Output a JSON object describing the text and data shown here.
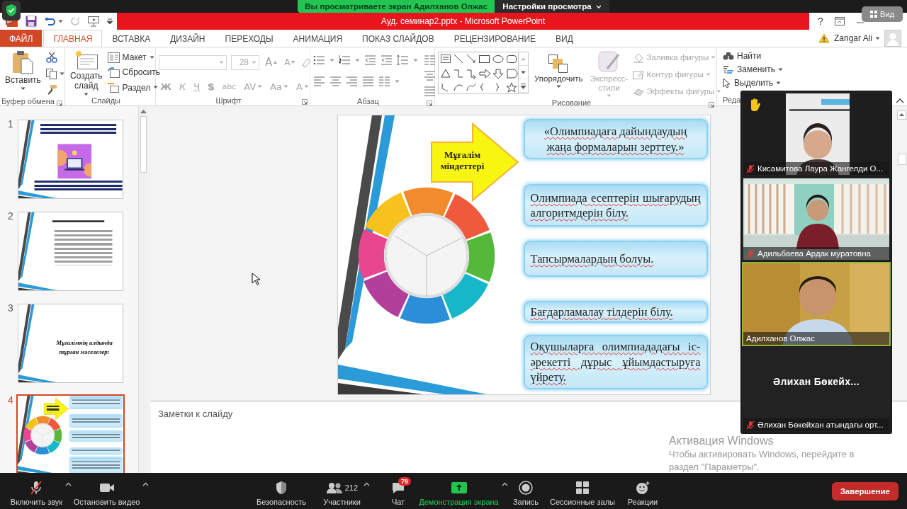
{
  "zoom_bar": {
    "viewing_notice": "Вы просматриваете экран Адилханов Олжас",
    "view_options": "Настройки просмотра",
    "view_button": "Вид"
  },
  "window": {
    "title": "Ауд. семинар2.pptx - Microsoft PowerPoint",
    "help": "?"
  },
  "ribbon_tabs": [
    {
      "label": "ФАЙЛ",
      "kind": "file",
      "selected": false
    },
    {
      "label": "ГЛАВНАЯ",
      "kind": "tab",
      "selected": true
    },
    {
      "label": "ВСТАВКА",
      "kind": "tab",
      "selected": false
    },
    {
      "label": "ДИЗАЙН",
      "kind": "tab",
      "selected": false
    },
    {
      "label": "ПЕРЕХОДЫ",
      "kind": "tab",
      "selected": false
    },
    {
      "label": "АНИМАЦИЯ",
      "kind": "tab",
      "selected": false
    },
    {
      "label": "ПОКАЗ СЛАЙДОВ",
      "kind": "tab",
      "selected": false
    },
    {
      "label": "РЕЦЕНЗИРОВАНИЕ",
      "kind": "tab",
      "selected": false
    },
    {
      "label": "ВИД",
      "kind": "tab",
      "selected": false
    }
  ],
  "account": {
    "name": "Zangar Ali"
  },
  "ribbon": {
    "clipboard": {
      "label": "Буфер обмена",
      "paste": "Вставить"
    },
    "slides": {
      "label": "Слайды",
      "new_slide": "Создать слайд",
      "commands": [
        {
          "label": "Макет",
          "kind": "layout",
          "menu": true
        },
        {
          "label": "Сбросить",
          "kind": "reset",
          "menu": false
        },
        {
          "label": "Раздел",
          "kind": "section",
          "menu": true
        }
      ]
    },
    "font": {
      "label": "Шрифт",
      "disabled": true,
      "size": "28",
      "size_buttons": [
        {
          "label": "A",
          "kind": "grow"
        },
        {
          "label": "A",
          "kind": "shrink"
        }
      ],
      "format_buttons": [
        {
          "label": "Ж",
          "kind": "bold",
          "menu": false
        },
        {
          "label": "К",
          "kind": "italic",
          "menu": false
        },
        {
          "label": "Ч",
          "kind": "underline",
          "menu": false
        },
        {
          "label": "S",
          "kind": "shadow",
          "menu": false
        },
        {
          "label": "abc",
          "kind": "strikethrough",
          "menu": false
        },
        {
          "label": "AV",
          "kind": "spacing",
          "menu": true
        },
        {
          "label": "Aa",
          "kind": "case",
          "menu": true
        },
        {
          "label": "A",
          "kind": "color",
          "menu": true
        }
      ]
    },
    "paragraph": {
      "label": "Абзац"
    },
    "drawing": {
      "label": "Рисование",
      "arrange": "Упорядочить",
      "quick_styles": {
        "label": "Экспресс-стили",
        "disabled": true
      },
      "shape_commands": [
        {
          "label": "Заливка фигуры",
          "kind": "fill",
          "disabled": true
        },
        {
          "label": "Контур фигуры",
          "kind": "outline",
          "disabled": true
        },
        {
          "label": "Эффекты фигуры",
          "kind": "effects",
          "disabled": true
        }
      ]
    },
    "editing": {
      "label": "Реда",
      "commands": [
        {
          "label": "Найти",
          "kind": "find",
          "menu": false
        },
        {
          "label": "Заменить",
          "kind": "replace",
          "menu": true
        },
        {
          "label": "Выделить",
          "kind": "select",
          "menu": true
        }
      ]
    }
  },
  "thumbnails": [
    {
      "number": "1",
      "selected": false,
      "slide": {
        "kind": "title"
      }
    },
    {
      "number": "2",
      "selected": false,
      "slide": {
        "kind": "text"
      }
    },
    {
      "number": "3",
      "selected": false,
      "slide": {
        "kind": "heading",
        "title": "Мұғалімнің алдында тұрған мәселелер:"
      }
    },
    {
      "number": "4",
      "selected": true,
      "slide": {
        "kind": "diagram"
      }
    }
  ],
  "slide": {
    "kind": "diagram",
    "arrow": "Мұғалім міндеттері",
    "spell_marked": true,
    "boxes": [
      "«Олимпиадаға дайындаудың жаңа формаларын зерттеу.»",
      "Олимпиада есептерін шығарудың алгоритмдерін білу.",
      "Тапсырмалардың болуы.",
      "Бағдарламалау тілдерін білу.",
      "Оқушыларға олимпиададағы іс-әрекетті дұрыс ұйымдастыруға үйрету."
    ]
  },
  "notes": {
    "placeholder": "Заметки к слайду"
  },
  "participants": [
    {
      "name": "Кисамитова Лаура Жангелди О...",
      "muted": true,
      "hand_raised": true,
      "speaking": false,
      "video": true
    },
    {
      "name": "Адильбаева Ардак муратовна",
      "muted": true,
      "hand_raised": false,
      "speaking": false,
      "video": true
    },
    {
      "name": "Адилханов Олжас",
      "muted": false,
      "hand_raised": false,
      "speaking": true,
      "video": true
    },
    {
      "name": "Әлихан Бөкейхан атындағы орт...",
      "display_name": "Әлихан Бөкейх...",
      "muted": true,
      "hand_raised": false,
      "speaking": false,
      "video": false
    }
  ],
  "toolbar": {
    "items": [
      {
        "label": "Включить звук",
        "kind": "mic",
        "muted": true,
        "menu": true
      },
      {
        "label": "Остановить видео",
        "kind": "video",
        "menu": true
      },
      {
        "label": "Безопасность",
        "kind": "security",
        "menu": false
      },
      {
        "label": "Участники",
        "kind": "participants",
        "count": "212",
        "menu": true
      },
      {
        "label": "Чат",
        "kind": "chat",
        "badge": "79",
        "menu": false
      },
      {
        "label": "Демонстрация экрана",
        "kind": "share",
        "menu": true
      },
      {
        "label": "Запись",
        "kind": "record",
        "menu": false
      },
      {
        "label": "Сессионные залы",
        "kind": "rooms",
        "menu": false
      },
      {
        "label": "Реакции",
        "kind": "reactions",
        "menu": false
      }
    ],
    "end_button": "Завершение"
  },
  "windows_watermark": {
    "title": "Активация Windows",
    "text": "Чтобы активировать Windows, перейдите в раздел \"Параметры\"."
  }
}
